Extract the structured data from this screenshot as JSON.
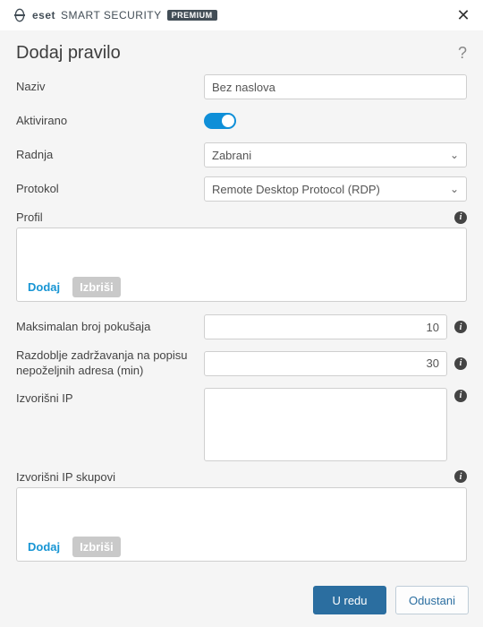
{
  "brand": {
    "eset": "eset",
    "name": "SMART SECURITY",
    "badge": "PREMIUM"
  },
  "dialog": {
    "title": "Dodaj pravilo",
    "help_tooltip": "?"
  },
  "fields": {
    "name": {
      "label": "Naziv",
      "value": "Bez naslova"
    },
    "enabled": {
      "label": "Aktivirano",
      "value": true
    },
    "action": {
      "label": "Radnja",
      "value": "Zabrani",
      "options": [
        "Zabrani"
      ]
    },
    "protocol": {
      "label": "Protokol",
      "value": "Remote Desktop Protocol (RDP)",
      "options": [
        "Remote Desktop Protocol (RDP)"
      ]
    },
    "profile": {
      "label": "Profil"
    },
    "max_attempts": {
      "label": "Maksimalan broj pokušaja",
      "value": "10"
    },
    "retention": {
      "label": "Razdoblje zadržavanja na popisu nepoželjnih adresa (min)",
      "value": "30"
    },
    "source_ip": {
      "label": "Izvorišni IP"
    },
    "source_ip_sets": {
      "label": "Izvorišni IP skupovi"
    }
  },
  "buttons": {
    "add": "Dodaj",
    "delete": "Izbriši",
    "ok": "U redu",
    "cancel": "Odustani"
  }
}
